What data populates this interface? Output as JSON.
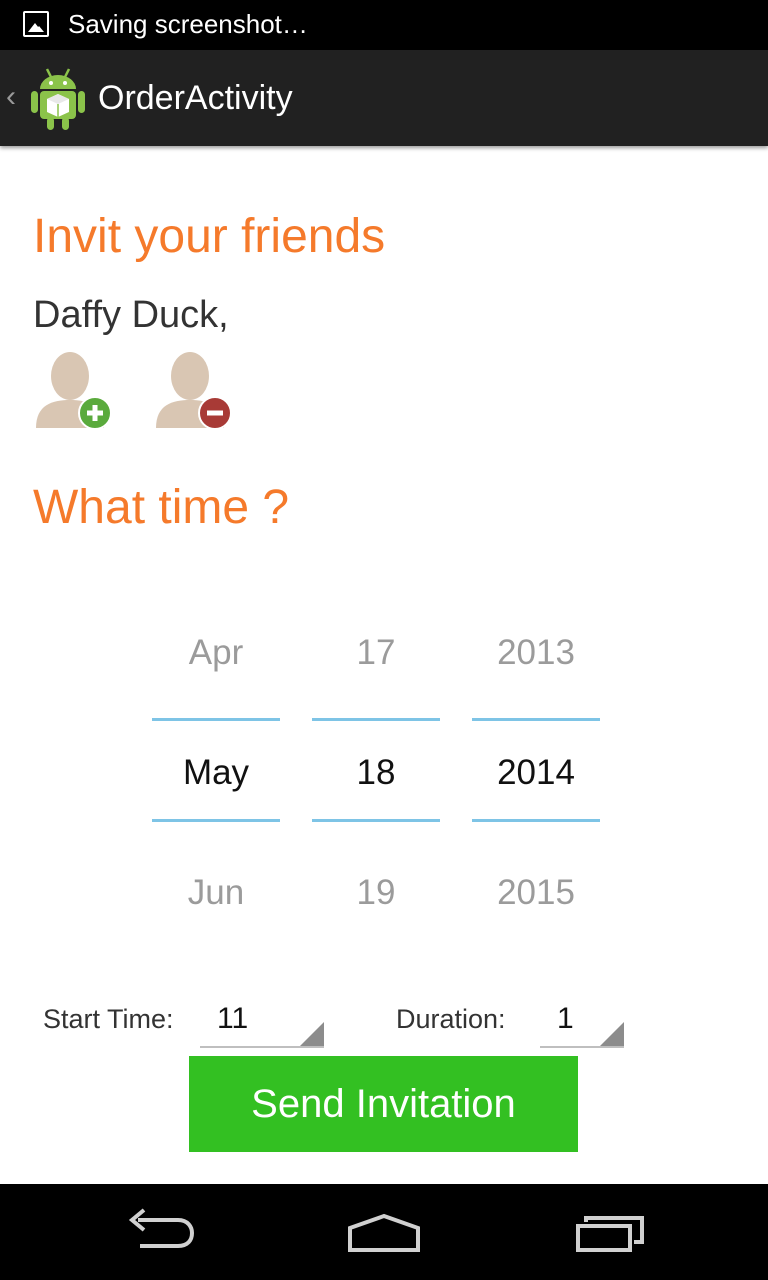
{
  "status_bar": {
    "text": "Saving screenshot…"
  },
  "action_bar": {
    "title": "OrderActivity"
  },
  "invite": {
    "heading": "Invit your friends",
    "friend_name": "Daffy Duck,"
  },
  "time": {
    "heading": "What time ?"
  },
  "date_picker": {
    "month": {
      "prev": "Apr",
      "current": "May",
      "next": "Jun"
    },
    "day": {
      "prev": "17",
      "current": "18",
      "next": "19"
    },
    "year": {
      "prev": "2013",
      "current": "2014",
      "next": "2015"
    }
  },
  "start_time": {
    "label": "Start Time:",
    "value": "11"
  },
  "duration": {
    "label": "Duration:",
    "value": "1"
  },
  "send_button": {
    "label": "Send Invitation"
  },
  "colors": {
    "accent": "#f57a2b",
    "button": "#33c022",
    "picker_divider": "#7ec4e6"
  },
  "icons": [
    "picture-icon",
    "android-logo-icon",
    "add-person-icon",
    "remove-person-icon",
    "back-icon",
    "home-icon",
    "recent-apps-icon"
  ]
}
